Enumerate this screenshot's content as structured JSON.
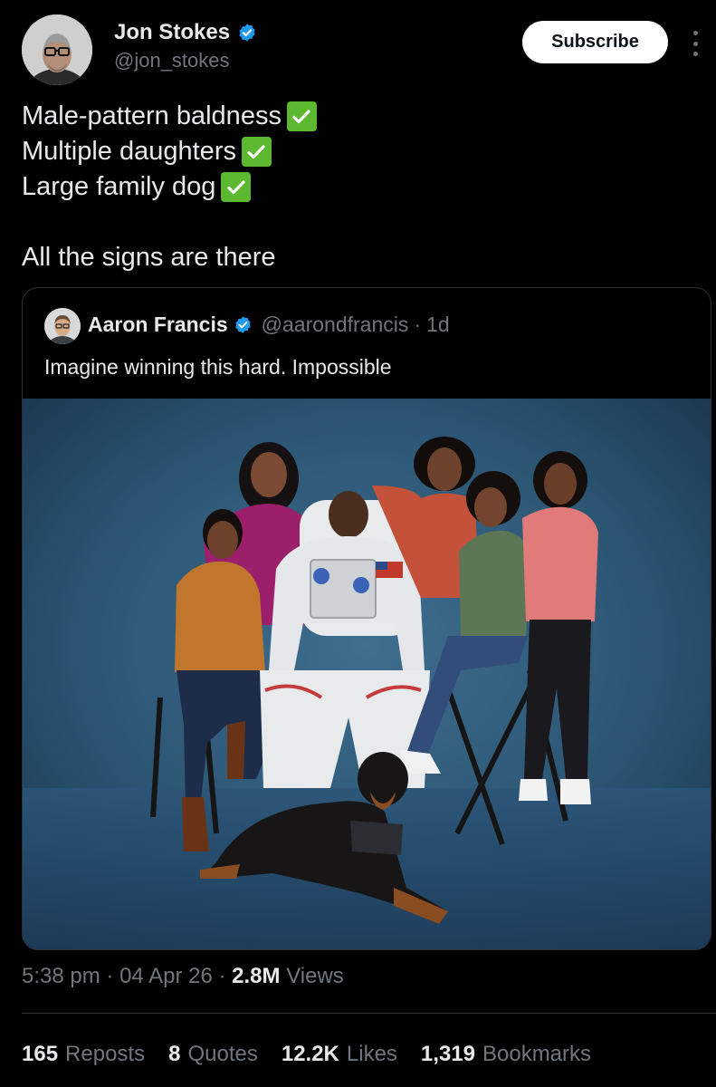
{
  "author": {
    "display_name": "Jon Stokes",
    "handle": "@jon_stokes",
    "verified": true,
    "avatar_icon": "profile-photo"
  },
  "header": {
    "subscribe_label": "Subscribe",
    "more_icon": "more-vertical-icon"
  },
  "tweet": {
    "lines": [
      "Male-pattern baldness",
      "Multiple daughters",
      "Large family dog"
    ],
    "check_icon": "white-heavy-check-mark",
    "closing": "All the signs are there"
  },
  "quote": {
    "display_name": "Aaron Francis",
    "handle": "@aarondfrancis",
    "age": "1d",
    "text": "Imagine winning this hard. Impossible"
  },
  "meta": {
    "time": "5:38 pm",
    "date": "04 Apr 26",
    "views_count": "2.8M",
    "views_label": "Views"
  },
  "stats": {
    "reposts_count": "165",
    "reposts_label": "Reposts",
    "quotes_count": "8",
    "quotes_label": "Quotes",
    "likes_count": "12.2K",
    "likes_label": "Likes",
    "bookmarks_count": "1,319",
    "bookmarks_label": "Bookmarks"
  },
  "colors": {
    "background": "#000000",
    "text": "#e7e9ea",
    "muted": "#71767b",
    "verified_blue": "#1d9bf0",
    "check_green": "#5cb82e",
    "border": "#2f3336"
  }
}
